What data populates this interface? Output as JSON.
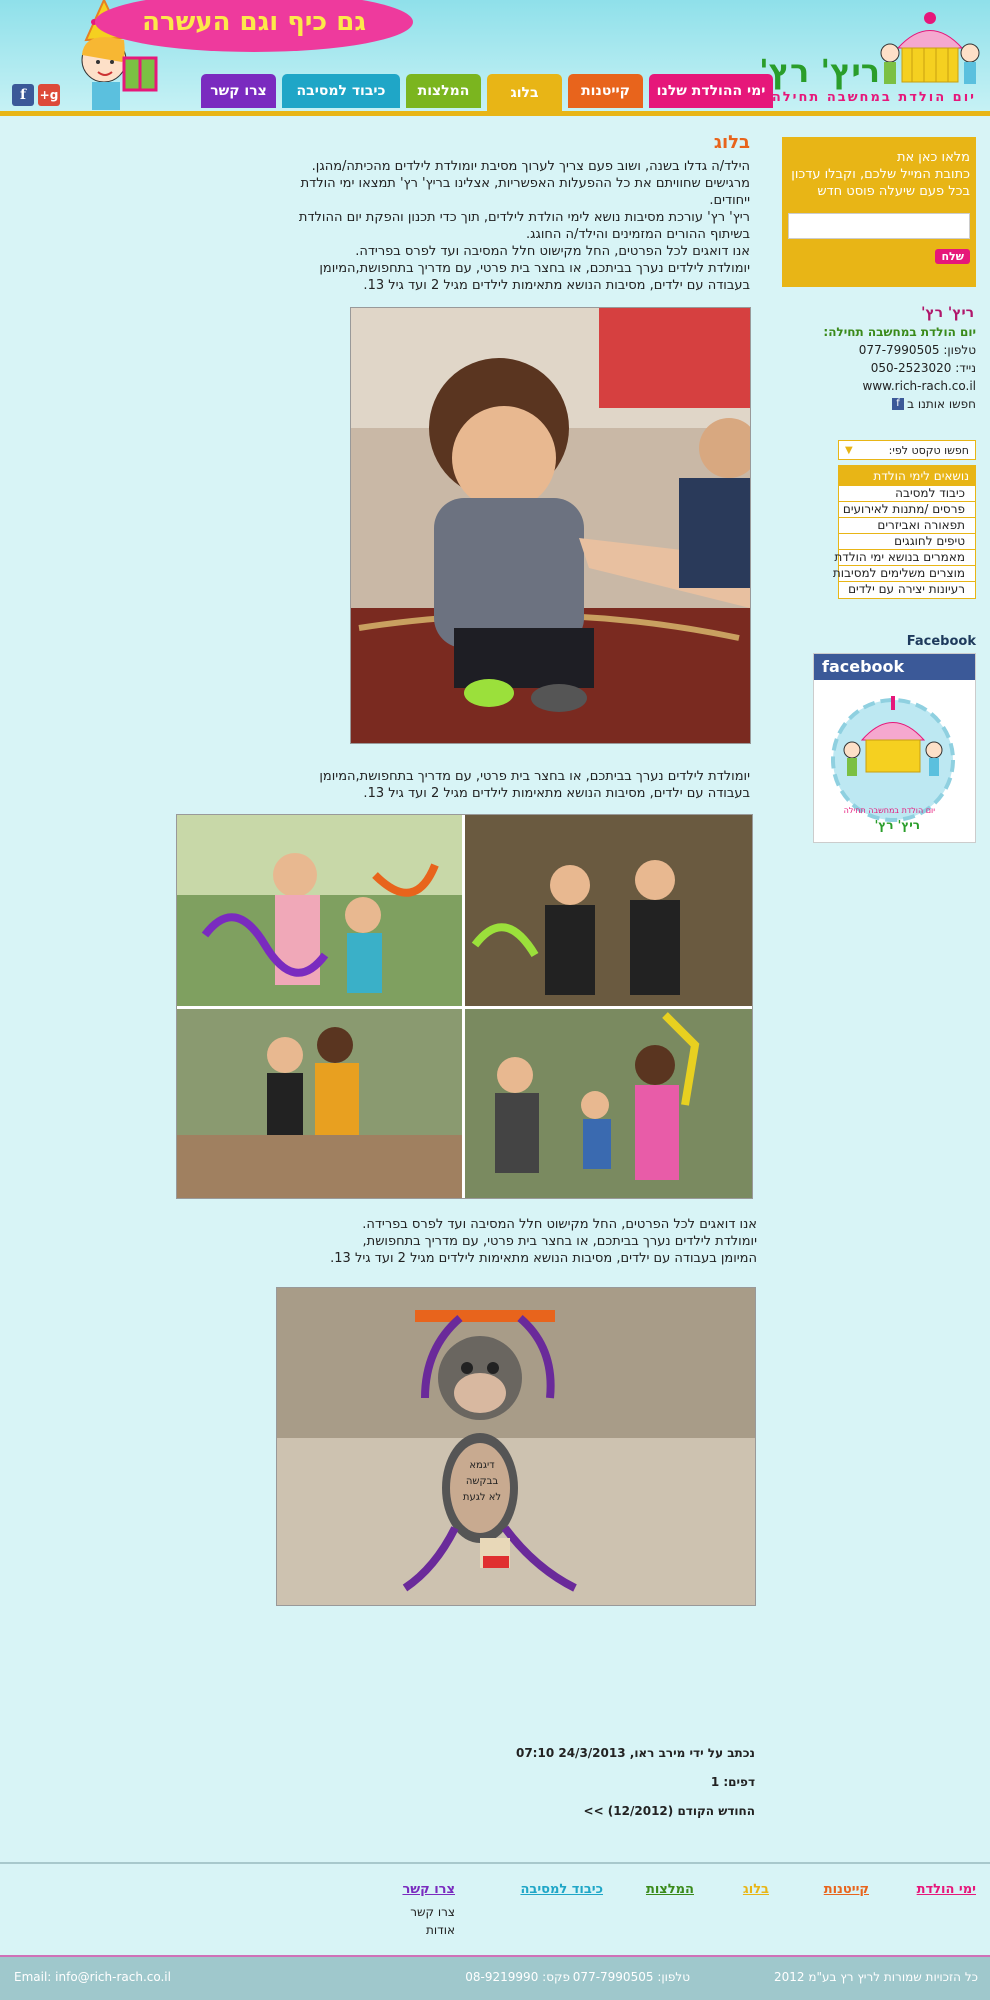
{
  "header": {
    "logo_name": "ריץ' רץ'",
    "logo_tagline": "יום הולדת במחשבה תחילה",
    "banner": "גם כיף וגם העשרה",
    "nav": [
      {
        "label": "ימי ההולדת שלנו",
        "color": "#e6177a"
      },
      {
        "label": "קייטנות",
        "color": "#e8641c"
      },
      {
        "label": "בלוג",
        "color": "#e8b516"
      },
      {
        "label": "המלצות",
        "color": "#7bb51f"
      },
      {
        "label": "כיבוד למסיבה",
        "color": "#1fa6c7"
      },
      {
        "label": "צרו קשר",
        "color": "#7a2bbf"
      }
    ],
    "social": [
      "facebook-icon",
      "google-plus-icon"
    ]
  },
  "sidebar": {
    "newsletter": {
      "text_lines": [
        "מלאו כאן את",
        "כתובת המייל שלכם, וקבלו עדכון",
        "בכל פעם שיעלה פוסט חדש"
      ],
      "input_placeholder": "",
      "submit": "שלח"
    },
    "contact": {
      "name": "ריץ' רץ'",
      "tagline": "יום הולדת במחשבה תחילה:",
      "phone_label": "טלפון:",
      "phone": "077-7990505",
      "mobile_label": "נייד:",
      "mobile": "050-2523020",
      "website": "www.rich-rach.co.il",
      "facebook_text": "חפשו אותנו ב"
    },
    "search_select": "חפשו טקסט לפי:",
    "categories": {
      "title": "נושאים לימי הולדת",
      "items": [
        "כיבוד למסיבה",
        "פרסים /מתנות לאירועים",
        "תפאורה ואביזרים",
        "טיפים לחוגגים",
        "מאמרים בנושא ימי הולדת",
        "מוצרים משלימים למסיבות",
        "רעיונות יצירה עם ילדים"
      ]
    },
    "facebook": {
      "title": "Facebook",
      "brand": "facebook",
      "widget_name": "ריץ' רץ'",
      "widget_tagline": "יום הולדת במחשבה תחילה"
    }
  },
  "main": {
    "title": "בלוג",
    "intro": [
      "הילד/ה גדלו בשנה, ושוב פעם צריך לערוך מסיבת יומולדת לילדים מהכיתה/מהגן.",
      "מרגישים שחוויתם את כל ההפעלות האפשריות, אצלינו בריץ' רץ' תמצאו ימי הולדת",
      "ייחודים.",
      "ריץ' רץ' עורכת מסיבות נושא לימי הולדת לילדים, תוך כדי תכנון והפקת יום ההולדת",
      "בשיתוף ההורים המזמינים והילד/ה החוגג.",
      "אנו דואגים לכל הפרטים, החל מקישוט חלל המסיבה ועד לפרס בפרידה.",
      "יומולדת לילדים נערך בביתכם, או בחצר בית פרטי, עם מדריך בתחפושת,המיומן",
      "בעבודה עם ילדים, מסיבות הנושא מתאימות לילדים מגיל 2 ועד גיל 13."
    ],
    "para2": [
      "יומולדת לילדים נערך בביתכם, או בחצר בית פרטי, עם מדריך בתחפושת,המיומן",
      "בעבודה עם ילדים, מסיבות הנושא מתאימות לילדים מגיל 2 ועד גיל 13."
    ],
    "para3": [
      "אנו דואגים לכל הפרטים, החל מקישוט חלל המסיבה ועד לפרס בפרידה.",
      "יומולדת לילדים נערך בביתכם, או בחצר בית פרטי, עם מדריך בתחפושת,",
      "המיומן בעבודה עם ילדים, מסיבות הנושא מתאימות לילדים מגיל 2 ועד גיל 13."
    ],
    "craft_text": [
      "דיגמא",
      "בבקשה",
      "לא לגעת"
    ],
    "post_meta": "נכתב על ידי מירב ראו, 24/3/2013 07:10",
    "pages": "דפים: 1",
    "prev_month": "החודש הקודם (12/2012) >>"
  },
  "footer": {
    "links": [
      {
        "label": "ימי הולדת",
        "color": "#e6177a"
      },
      {
        "label": "קייטנות",
        "color": "#e8641c"
      },
      {
        "label": "בלוג",
        "color": "#e8b516"
      },
      {
        "label": "המלצות",
        "color": "#3a8a1a"
      },
      {
        "label": "כיבוד למסיבה",
        "color": "#1fa6c7"
      },
      {
        "label": "צרו קשר",
        "color": "#7a2bbf"
      }
    ],
    "sub": [
      "צרו קשר",
      "אודות"
    ],
    "copyright": "כל הזכויות שמורות לריץ רץ בע\"מ 2012",
    "phone_label": "טלפון:",
    "phone": "077-7990505",
    "fax_label": "פקס:",
    "fax": "08-9219990",
    "email": "Email: info@rich-rach.co.il"
  }
}
